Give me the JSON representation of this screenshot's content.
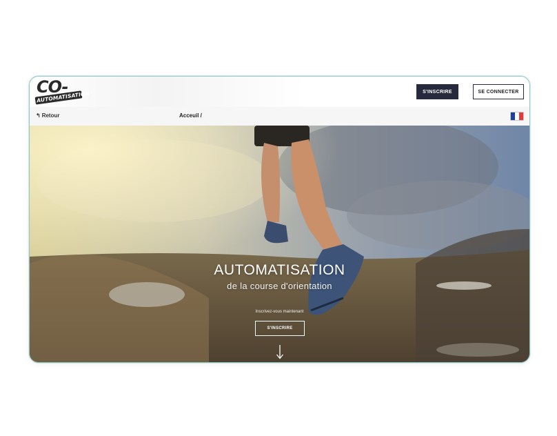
{
  "logo": {
    "main": "CO-",
    "tagline": "AUTOMATISATION"
  },
  "header": {
    "signup_label": "S'INSCRIRE",
    "login_label": "SE CONNECTER"
  },
  "subbar": {
    "back_label": "Retour",
    "breadcrumb": "Acceuil /",
    "language_flag": "fr-flag-icon"
  },
  "hero": {
    "title": "AUTOMATISATION",
    "subtitle": "de la course d'orientation",
    "cta_text": "Inscrivez-vous maintenant",
    "cta_button": "S'INSCRIRE",
    "scroll_icon": "arrow-down-icon"
  },
  "colors": {
    "primary_dark": "#272a3d",
    "flag_blue": "#1f3f9e",
    "flag_white": "#ffffff",
    "flag_red": "#e23b3b"
  }
}
